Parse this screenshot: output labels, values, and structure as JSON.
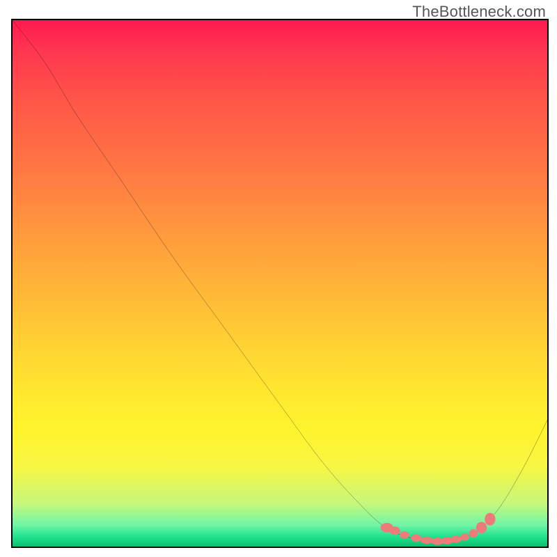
{
  "watermark": "TheBottleneck.com",
  "chart_data": {
    "type": "line",
    "title": "",
    "xlabel": "",
    "ylabel": "",
    "xlim": [
      0,
      100
    ],
    "ylim": [
      0,
      100
    ],
    "curve": [
      {
        "x": 0,
        "y": 100
      },
      {
        "x": 6,
        "y": 92
      },
      {
        "x": 12,
        "y": 82
      },
      {
        "x": 20,
        "y": 70
      },
      {
        "x": 30,
        "y": 55
      },
      {
        "x": 40,
        "y": 41
      },
      {
        "x": 50,
        "y": 27
      },
      {
        "x": 58,
        "y": 16
      },
      {
        "x": 65,
        "y": 8
      },
      {
        "x": 70,
        "y": 3.5
      },
      {
        "x": 75,
        "y": 1.5
      },
      {
        "x": 80,
        "y": 1.0
      },
      {
        "x": 85,
        "y": 1.8
      },
      {
        "x": 90,
        "y": 6
      },
      {
        "x": 95,
        "y": 14
      },
      {
        "x": 100,
        "y": 24
      }
    ],
    "markers": [
      {
        "x": 70,
        "y": 3.6,
        "rx": 1.2,
        "ry": 0.9
      },
      {
        "x": 71.5,
        "y": 3.0,
        "rx": 1.0,
        "ry": 0.8
      },
      {
        "x": 73.3,
        "y": 2.2,
        "rx": 0.9,
        "ry": 0.7
      },
      {
        "x": 75.5,
        "y": 1.6,
        "rx": 1.0,
        "ry": 0.7
      },
      {
        "x": 77.5,
        "y": 1.2,
        "rx": 1.2,
        "ry": 0.7
      },
      {
        "x": 79.5,
        "y": 1.0,
        "rx": 1.2,
        "ry": 0.7
      },
      {
        "x": 81.3,
        "y": 1.1,
        "rx": 1.1,
        "ry": 0.7
      },
      {
        "x": 83.0,
        "y": 1.4,
        "rx": 1.0,
        "ry": 0.7
      },
      {
        "x": 84.6,
        "y": 1.8,
        "rx": 0.8,
        "ry": 0.7
      },
      {
        "x": 86.2,
        "y": 2.5,
        "rx": 0.8,
        "ry": 0.8
      },
      {
        "x": 87.7,
        "y": 3.6,
        "rx": 1.0,
        "ry": 1.1
      },
      {
        "x": 89.3,
        "y": 5.2,
        "rx": 1.0,
        "ry": 1.2
      }
    ],
    "background_gradient": [
      {
        "stop": 0.0,
        "color": "#ff1a50"
      },
      {
        "stop": 0.5,
        "color": "#ffbd37"
      },
      {
        "stop": 0.8,
        "color": "#fff42e"
      },
      {
        "stop": 1.0,
        "color": "#0dbf6e"
      }
    ],
    "curve_color": "#000000",
    "marker_color": "#ed7b79"
  }
}
